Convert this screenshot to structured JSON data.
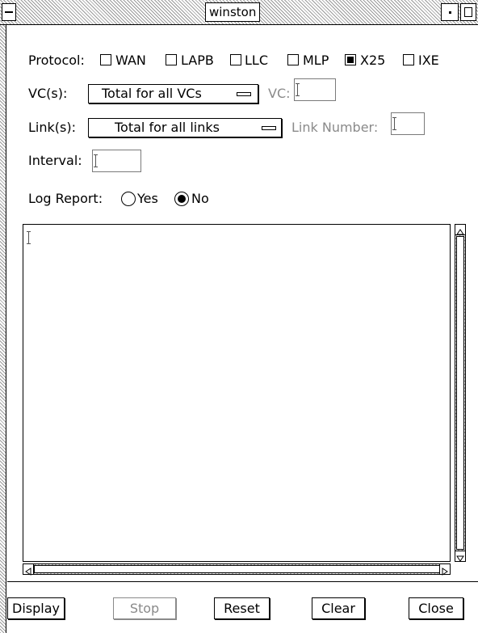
{
  "window": {
    "title": "winston"
  },
  "protocol": {
    "label": "Protocol:",
    "options": [
      {
        "label": "WAN",
        "checked": false
      },
      {
        "label": "LAPB",
        "checked": false
      },
      {
        "label": "LLC",
        "checked": false
      },
      {
        "label": "MLP",
        "checked": false
      },
      {
        "label": "X25",
        "checked": true
      },
      {
        "label": "IXE",
        "checked": false
      }
    ]
  },
  "vcs": {
    "label": "VC(s):",
    "selected": "Total for all VCs",
    "vc_label": "VC:",
    "vc_value": ""
  },
  "links": {
    "label": "Link(s):",
    "selected": "Total for all links",
    "link_number_label": "Link Number:",
    "link_number_value": ""
  },
  "interval": {
    "label": "Interval:",
    "value": ""
  },
  "log_report": {
    "label": "Log Report:",
    "options": [
      {
        "label": "Yes",
        "selected": false
      },
      {
        "label": "No",
        "selected": true
      }
    ]
  },
  "log_output": {
    "text": ""
  },
  "buttons": {
    "display": "Display",
    "stop": "Stop",
    "reset": "Reset",
    "clear": "Clear",
    "close": "Close"
  },
  "icons": {
    "window_menu": "window-menu-icon",
    "minimize": "minimize-icon",
    "maximize": "maximize-icon"
  }
}
